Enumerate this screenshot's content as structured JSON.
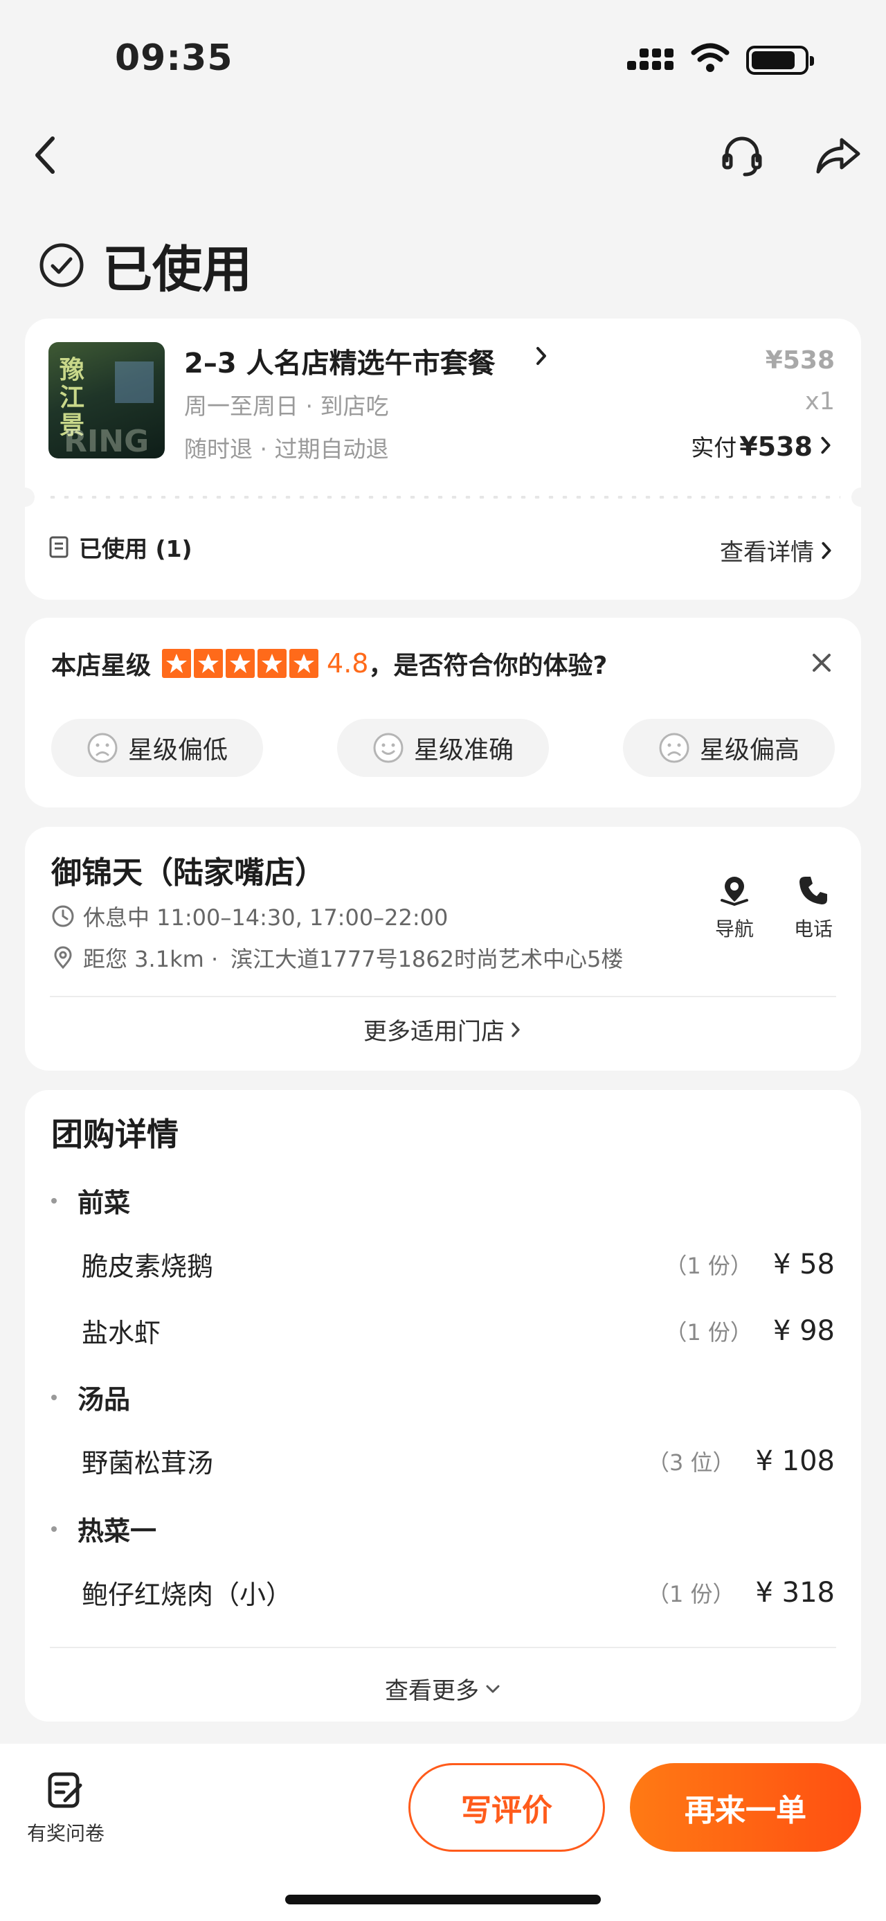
{
  "status_bar": {
    "time": "09:35"
  },
  "order": {
    "status": "已使用",
    "product": {
      "name": "2–3 人名店精选午市套餐",
      "thumb_text": "豫江景",
      "thumb_overlay": "RING",
      "meta1": "周一至周日 · 到店吃",
      "meta2": "随时退 · 过期自动退",
      "original_price": "¥538",
      "quantity": "x1",
      "paid_label": "实付",
      "paid_amount": "¥538"
    },
    "used_label": "已使用 (1)",
    "detail_link": "查看详情"
  },
  "rating": {
    "prefix": "本店星级",
    "stars": 5,
    "score": "4.8",
    "question": "，是否符合你的体验?",
    "options": [
      "星级偏低",
      "星级准确",
      "星级偏高"
    ]
  },
  "store": {
    "name": "御锦天（陆家嘴店）",
    "hours": "休息中 11:00–14:30, 17:00–22:00",
    "distance": "距您 3.1km ·",
    "address": "滨江大道1777号1862时尚艺术中心5楼",
    "nav_label": "导航",
    "phone_label": "电话",
    "more_stores": "更多适用门店"
  },
  "deal": {
    "title": "团购详情",
    "sections": [
      {
        "category": "前菜",
        "items": [
          {
            "name": "脆皮素烧鹅",
            "unit": "（1 份）",
            "price": "¥ 58"
          },
          {
            "name": "盐水虾",
            "unit": "（1 份）",
            "price": "¥ 98"
          }
        ]
      },
      {
        "category": "汤品",
        "items": [
          {
            "name": "野菌松茸汤",
            "unit": "（3 位）",
            "price": "¥ 108"
          }
        ]
      },
      {
        "category": "热菜一",
        "items": [
          {
            "name": "鲍仔红烧肉（小）",
            "unit": "（1 份）",
            "price": "¥ 318"
          }
        ]
      }
    ],
    "see_more": "查看更多"
  },
  "bottom_bar": {
    "survey_label": "有奖问卷",
    "review_button": "写评价",
    "reorder_button": "再来一单"
  },
  "colors": {
    "accent": "#ff5b1b",
    "star": "#ff6a1a"
  }
}
